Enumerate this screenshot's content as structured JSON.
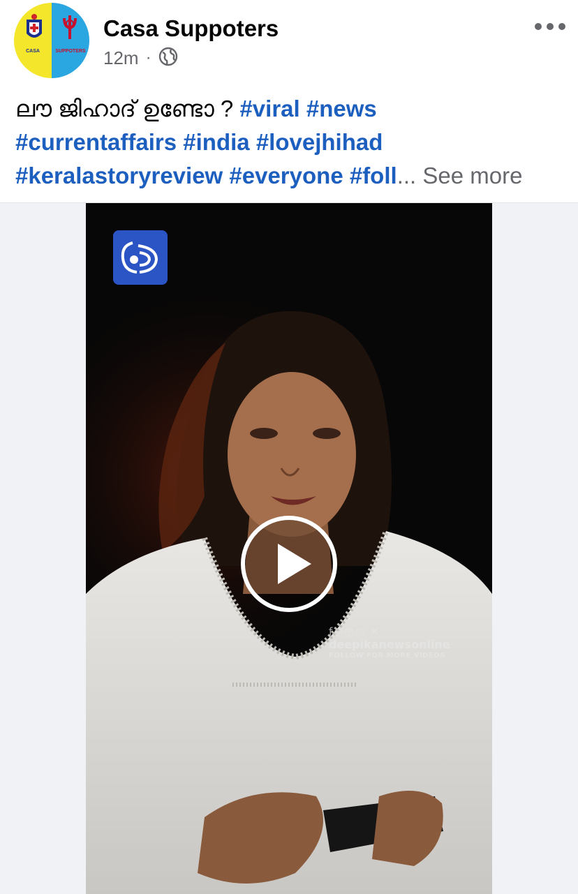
{
  "post": {
    "author": "Casa Suppoters",
    "time": "12m",
    "visibility_icon": "globe-icon",
    "menu_icon": "more-horizontal-icon",
    "avatar": {
      "left_label": "CASA",
      "right_label": "SUPPOTERS",
      "colors": {
        "left": "#f4e62a",
        "right": "#2aa6e0"
      }
    },
    "caption": {
      "line1_text": "ലൗ ജിഹാദ് ഉണ്ടോ ?",
      "line1_tags": [
        "#viral",
        "#news"
      ],
      "line2_tags": [
        "#currentaffairs",
        "#india",
        "#lovejhihad"
      ],
      "line3_tags": [
        "#keralastoryreview",
        "#everyone",
        "#foll"
      ],
      "ellipsis": "...",
      "see_more": "See more"
    }
  },
  "video": {
    "play_icon": "play-icon",
    "channel_logo_icon": "deepika-logo-icon",
    "watermark": {
      "icons": "f◎◎◎ ✕",
      "handle": "deepikanewsonline",
      "tagline": "FOLLOW FOR MORE VIDEOS"
    }
  },
  "colors": {
    "hashtag": "#1d5fbf",
    "secondary_text": "#65676b",
    "media_background": "#f0f2f5"
  }
}
